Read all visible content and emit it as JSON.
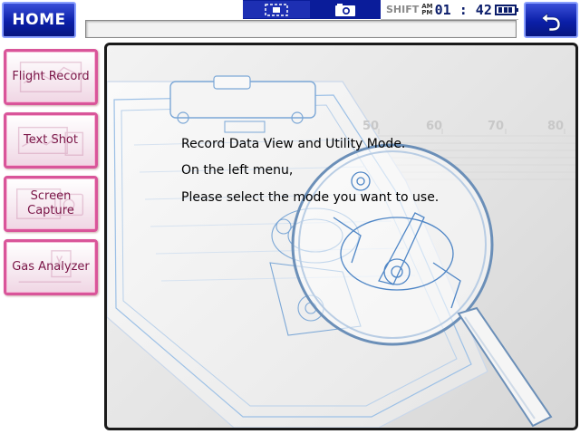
{
  "header": {
    "home_label": "HOME",
    "shift_label": "SHIFT",
    "am_label": "AM",
    "pm_label": "PM",
    "clock": "01 : 42",
    "address_value": "",
    "icons": {
      "left_status": "focus-frame-icon",
      "camera": "camera-icon",
      "battery": "battery-icon",
      "back": "back-arrow-icon"
    }
  },
  "sidebar": {
    "items": [
      {
        "label": "Flight Record"
      },
      {
        "label": "Text Shot"
      },
      {
        "label": "Screen Capture"
      },
      {
        "label": "Gas Analyzer"
      }
    ]
  },
  "main": {
    "lines": [
      "Record Data View and Utility Mode.",
      "On the left menu,",
      "Please select the mode you want to use."
    ],
    "ruler_ticks": [
      "50",
      "60",
      "70",
      "80"
    ]
  },
  "colors": {
    "accent_blue": "#0b1fa8",
    "sidebar_pink": "#d9559a",
    "sidebar_text": "#7a1547"
  }
}
